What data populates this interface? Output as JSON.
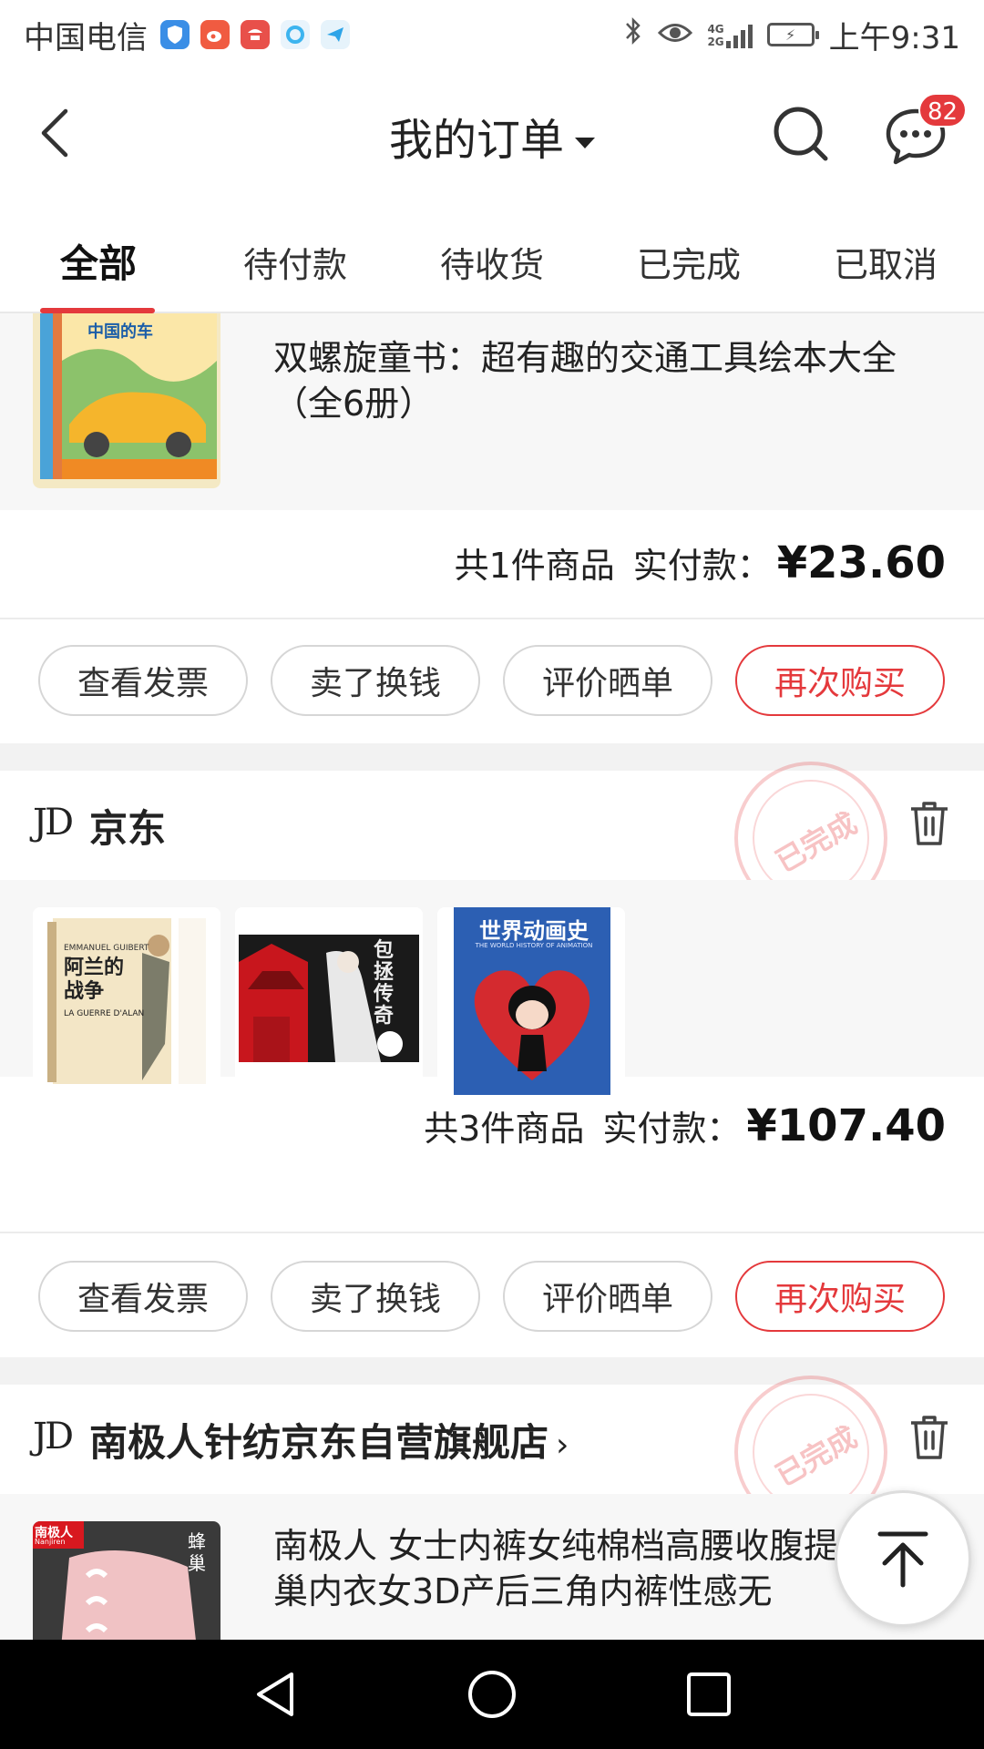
{
  "status_bar": {
    "carrier": "中国电信",
    "time": "上午9:31",
    "network": "4G",
    "network2": "2G",
    "apps": [
      {
        "name": "shield-app",
        "color": "#3a8ee6"
      },
      {
        "name": "weibo-app",
        "color": "#f05b41"
      },
      {
        "name": "fengyu-app",
        "color": "#e8504a"
      },
      {
        "name": "qq-browser-app",
        "color": "#3cb4ef"
      },
      {
        "name": "feiji-app",
        "color": "#2da4e8"
      }
    ]
  },
  "header": {
    "title": "我的订单",
    "message_badge": "82"
  },
  "tabs": [
    "全部",
    "待付款",
    "待收货",
    "已完成",
    "已取消"
  ],
  "orders": [
    {
      "product_title": "双螺旋童书：超有趣的交通工具绘本大全（全6册）",
      "thumb_text": "中国的车",
      "summary_count": "共1件商品",
      "summary_label": "实付款：",
      "amount": "¥23.60",
      "buttons": [
        "查看发票",
        "卖了换钱",
        "评价晒单",
        "再次购买"
      ]
    },
    {
      "shop": "京东",
      "jd_logo": "JD",
      "stamp": "已完成",
      "thumbs": [
        {
          "title": "阿兰的战争",
          "sub": "LA GUERRE D'ALAN",
          "author": "EMMANUEL GUIBERT"
        },
        {
          "title": "包拯传奇"
        },
        {
          "title": "世界动画史",
          "sub": "THE WORLD HISTORY OF ANIMATION"
        }
      ],
      "summary_count": "共3件商品",
      "summary_label": "实付款：",
      "amount": "¥107.40",
      "buttons": [
        "查看发票",
        "卖了换钱",
        "评价晒单",
        "再次购买"
      ]
    },
    {
      "shop": "南极人针纺京东自营旗舰店",
      "jd_logo": "JD",
      "stamp": "已完成",
      "thumb_brand": "南极人",
      "thumb_brand_sub": "Nanjiren",
      "thumb_text": "蜂巢",
      "product_title": "南极人 女士内裤女纯棉档高腰收腹提臀蜂巢内衣女3D产后三角内裤性感无"
    }
  ]
}
